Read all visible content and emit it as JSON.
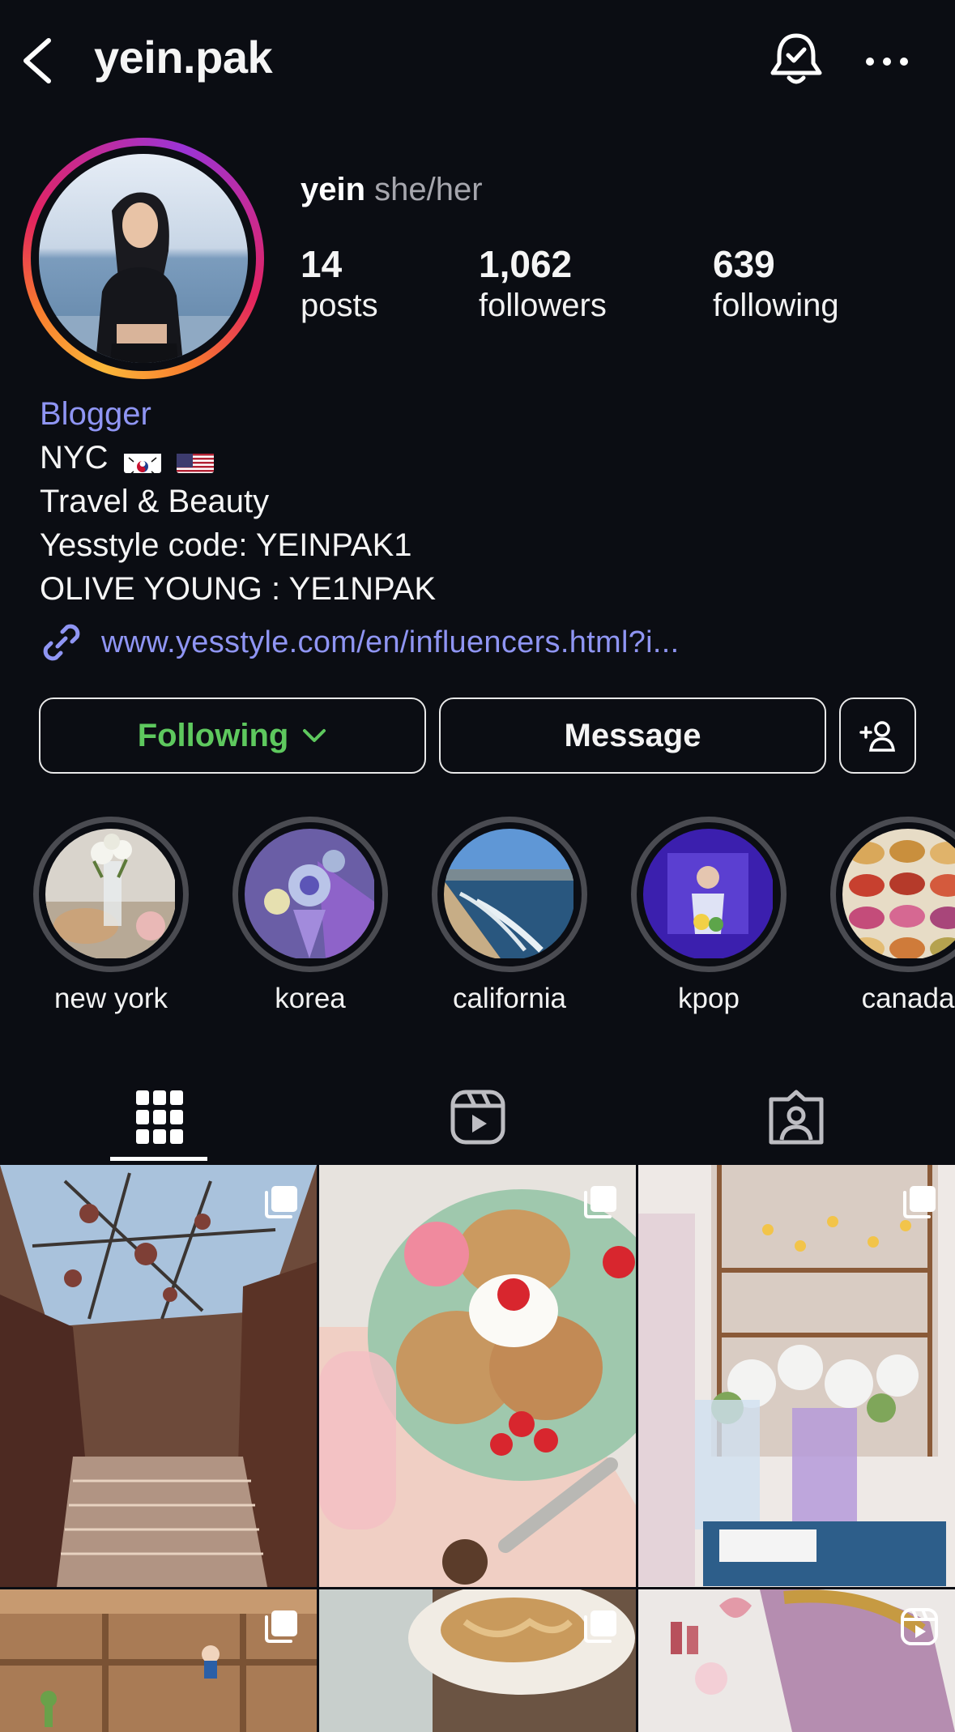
{
  "header": {
    "username": "yein.pak"
  },
  "profile": {
    "name": "yein",
    "pronouns": "she/her",
    "stats": [
      {
        "value": "14",
        "label": "posts"
      },
      {
        "value": "1,062",
        "label": "followers"
      },
      {
        "value": "639",
        "label": "following"
      }
    ],
    "category": "Blogger",
    "bio": {
      "line1": "NYC",
      "line2": "Travel & Beauty",
      "line3": "Yesstyle code: YEINPAK1",
      "line4": "OLIVE YOUNG : YE1NPAK"
    },
    "link": "www.yesstyle.com/en/influencers.html?i..."
  },
  "actions": {
    "following": "Following",
    "message": "Message"
  },
  "highlights": [
    {
      "label": "new york"
    },
    {
      "label": "korea"
    },
    {
      "label": "california"
    },
    {
      "label": "kpop"
    },
    {
      "label": "canada"
    }
  ],
  "icons": [
    "back-icon",
    "bell-check-icon",
    "more-icon",
    "link-icon",
    "chevron-down-icon",
    "add-person-icon",
    "grid-icon",
    "reels-icon",
    "tagged-icon",
    "carousel-icon",
    "reel-icon"
  ],
  "colors": {
    "background": "#0b0d13",
    "accent_link": "#8f95f3",
    "following_green": "#5ec85e"
  }
}
